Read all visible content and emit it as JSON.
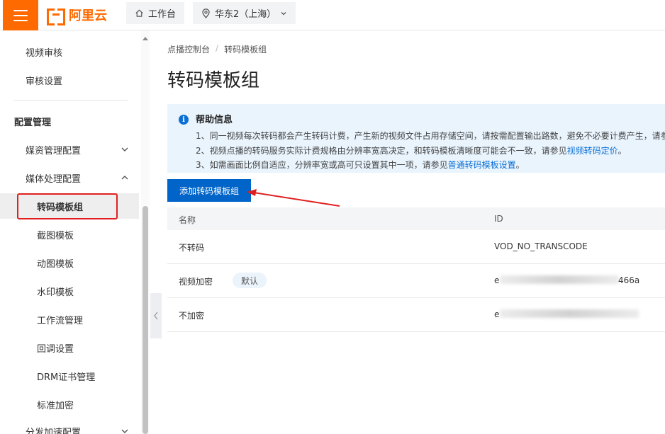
{
  "topbar": {
    "logo_text": "阿里云",
    "workbench_label": "工作台",
    "region_label": "华东2（上海）"
  },
  "sidebar": {
    "items": [
      {
        "label": "视频审核"
      },
      {
        "label": "审核设置"
      },
      {
        "label": "配置管理"
      },
      {
        "label": "媒资管理配置"
      },
      {
        "label": "媒体处理配置"
      },
      {
        "label": "转码模板组"
      },
      {
        "label": "截图模板"
      },
      {
        "label": "动图模板"
      },
      {
        "label": "水印模板"
      },
      {
        "label": "工作流管理"
      },
      {
        "label": "回调设置"
      },
      {
        "label": "DRM证书管理"
      },
      {
        "label": "标准加密"
      },
      {
        "label": "分发加速配置"
      }
    ]
  },
  "breadcrumb": {
    "root": "点播控制台",
    "separator": "/",
    "current": "转码模板组"
  },
  "page_title": "转码模板组",
  "help": {
    "title": "帮助信息",
    "line1": "1、同一视频每次转码都会产生转码计费，产生新的视频文件占用存储空间，请按需配置输出路数，避免不必要计费产生，请参",
    "line2_text": "2、视频点播的转码服务实际计费规格由分辨率宽高决定，和转码模板清晰度可能会不一致，请参见",
    "line2_link": "视频转码定价",
    "line2_end": "。",
    "line3_text": "3、如需画面比例自适应，分辨率宽或高可只设置其中一项，请参见",
    "line3_link": "普通转码模板设置",
    "line3_end": "。"
  },
  "add_button": "添加转码模板组",
  "table": {
    "columns": [
      "名称",
      "ID"
    ],
    "rows": [
      {
        "name": "不转码",
        "id": "VOD_NO_TRANSCODE",
        "badge": ""
      },
      {
        "name": "视频加密",
        "id_prefix": "e",
        "id_suffix": "466a",
        "badge": "默认"
      },
      {
        "name": "不加密",
        "id_prefix": "e",
        "id_suffix": "",
        "badge": ""
      }
    ]
  },
  "colors": {
    "brand": "#ff6a00",
    "primary": "#0064c8",
    "link": "#0b6fd6",
    "help_bg": "#e9f4fd",
    "highlight": "#e02020"
  }
}
